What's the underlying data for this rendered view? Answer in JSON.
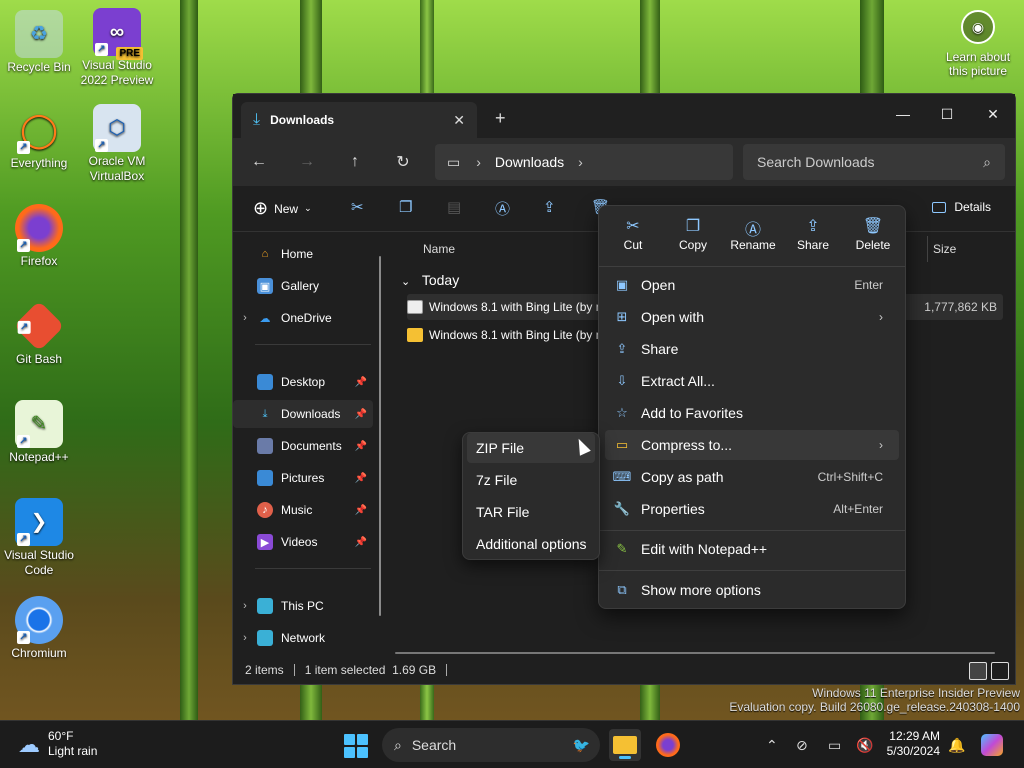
{
  "desktop": {
    "icons": [
      {
        "label": "Recycle Bin"
      },
      {
        "label": "Visual Studio 2022 Preview",
        "badge": "PRE"
      },
      {
        "label": "Everything"
      },
      {
        "label": "Oracle VM VirtualBox"
      },
      {
        "label": "Firefox"
      },
      {
        "label": "Git Bash"
      },
      {
        "label": "Notepad++"
      },
      {
        "label": "Visual Studio Code"
      },
      {
        "label": "Chromium"
      }
    ],
    "learn_picture": "Learn about this picture"
  },
  "explorer": {
    "tab_title": "Downloads",
    "address": {
      "location": "Downloads"
    },
    "search_placeholder": "Search Downloads",
    "toolbar": {
      "new_label": "New",
      "details_label": "Details"
    },
    "nav": [
      {
        "label": "Home"
      },
      {
        "label": "Gallery"
      },
      {
        "label": "OneDrive"
      },
      {
        "label": "Desktop"
      },
      {
        "label": "Downloads"
      },
      {
        "label": "Documents"
      },
      {
        "label": "Pictures"
      },
      {
        "label": "Music"
      },
      {
        "label": "Videos"
      },
      {
        "label": "This PC"
      },
      {
        "label": "Network"
      }
    ],
    "columns": {
      "name": "Name",
      "size": "Size"
    },
    "group": "Today",
    "files": [
      {
        "name": "Windows 8.1 with Bing Lite (by n",
        "size": "1,777,862 KB"
      },
      {
        "name": "Windows 8.1 with Bing Lite (by n",
        "size": ""
      }
    ],
    "status": {
      "items": "2 items",
      "selected": "1 item selected  1.69 GB"
    }
  },
  "context_menu": {
    "quick_actions": [
      "Cut",
      "Copy",
      "Rename",
      "Share",
      "Delete"
    ],
    "items": [
      {
        "label": "Open",
        "accel": "Enter"
      },
      {
        "label": "Open with",
        "accel": ""
      },
      {
        "label": "Share",
        "accel": ""
      },
      {
        "label": "Extract All...",
        "accel": ""
      },
      {
        "label": "Add to Favorites",
        "accel": ""
      },
      {
        "label": "Compress to...",
        "accel": ""
      },
      {
        "label": "Copy as path",
        "accel": "Ctrl+Shift+C"
      },
      {
        "label": "Properties",
        "accel": "Alt+Enter"
      },
      {
        "label": "Edit with Notepad++",
        "accel": ""
      },
      {
        "label": "Show more options",
        "accel": ""
      }
    ]
  },
  "submenu": [
    "ZIP File",
    "7z File",
    "TAR File",
    "Additional options"
  ],
  "watermark": {
    "line1": "Windows 11 Enterprise Insider Preview",
    "line2": "Evaluation copy. Build 26080.ge_release.240308-1400"
  },
  "taskbar": {
    "weather_temp": "60°F",
    "weather_desc": "Light rain",
    "search_label": "Search",
    "time": "12:29 AM",
    "date": "5/30/2024"
  },
  "colors": {
    "accent": "#4cc2ff",
    "icon_blue": "#8ec8ff"
  }
}
